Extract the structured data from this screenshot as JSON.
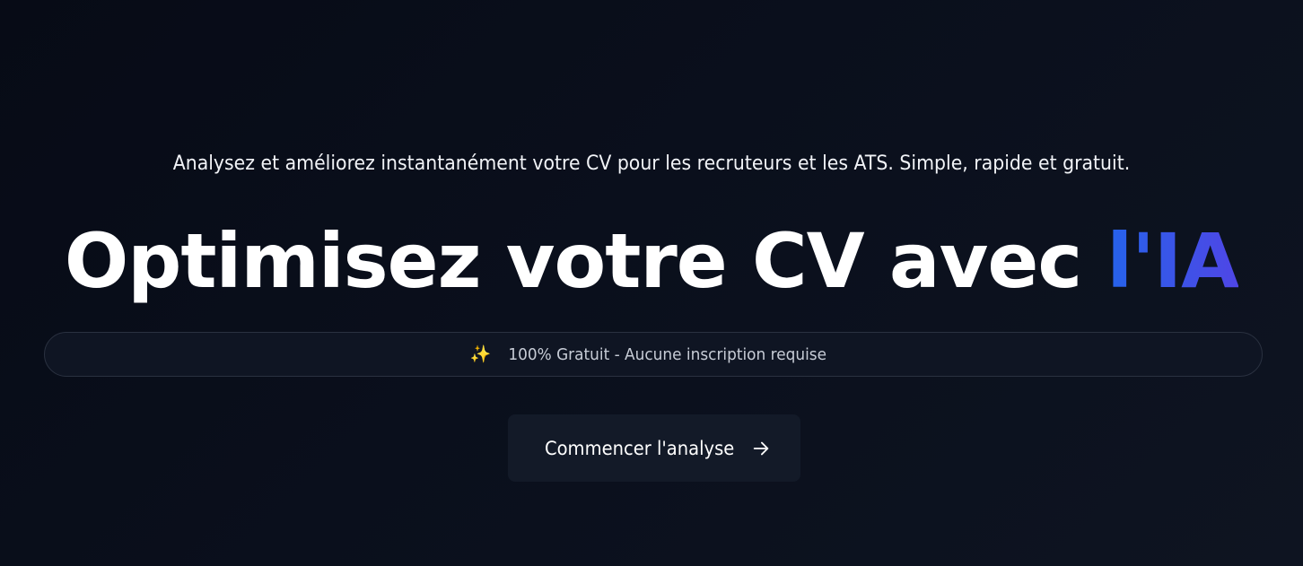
{
  "hero": {
    "subtitle": "Analysez et améliorez instantanément votre CV pour les recruteurs et les ATS. Simple, rapide et gratuit.",
    "headline_main": "Optimisez votre CV avec ",
    "headline_accent": "l'IA",
    "accent_color_start": "#2563eb",
    "accent_color_end": "#4f46e5"
  },
  "badge": {
    "icon": "sparkles-icon",
    "text": "100% Gratuit - Aucune inscription requise"
  },
  "cta": {
    "label": "Commencer l'analyse",
    "icon": "arrow-right-icon"
  }
}
